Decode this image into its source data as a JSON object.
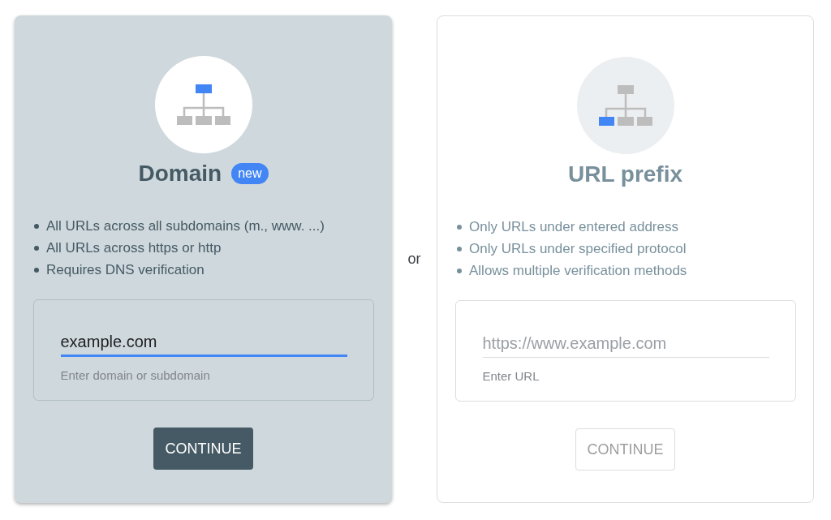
{
  "cards": [
    {
      "selected": true,
      "title": "Domain",
      "badge": "new",
      "kind": "domain",
      "bullets": [
        "All URLs across all subdomains (m., www. ...)",
        "All URLs across https or http",
        "Requires DNS verification"
      ],
      "field": {
        "value": "example.com",
        "focused": true,
        "helper": "Enter domain or subdomain"
      },
      "button": {
        "label": "CONTINUE",
        "disabled": false
      }
    },
    {
      "selected": false,
      "title": "URL prefix",
      "kind": "prefix",
      "bullets": [
        "Only URLs under entered address",
        "Only URLs under specified protocol",
        "Allows multiple verification methods"
      ],
      "field": {
        "placeholder": "https://www.example.com",
        "focused": false,
        "helper": "Enter URL"
      },
      "button": {
        "label": "CONTINUE",
        "disabled": true
      }
    }
  ],
  "separator": "or"
}
